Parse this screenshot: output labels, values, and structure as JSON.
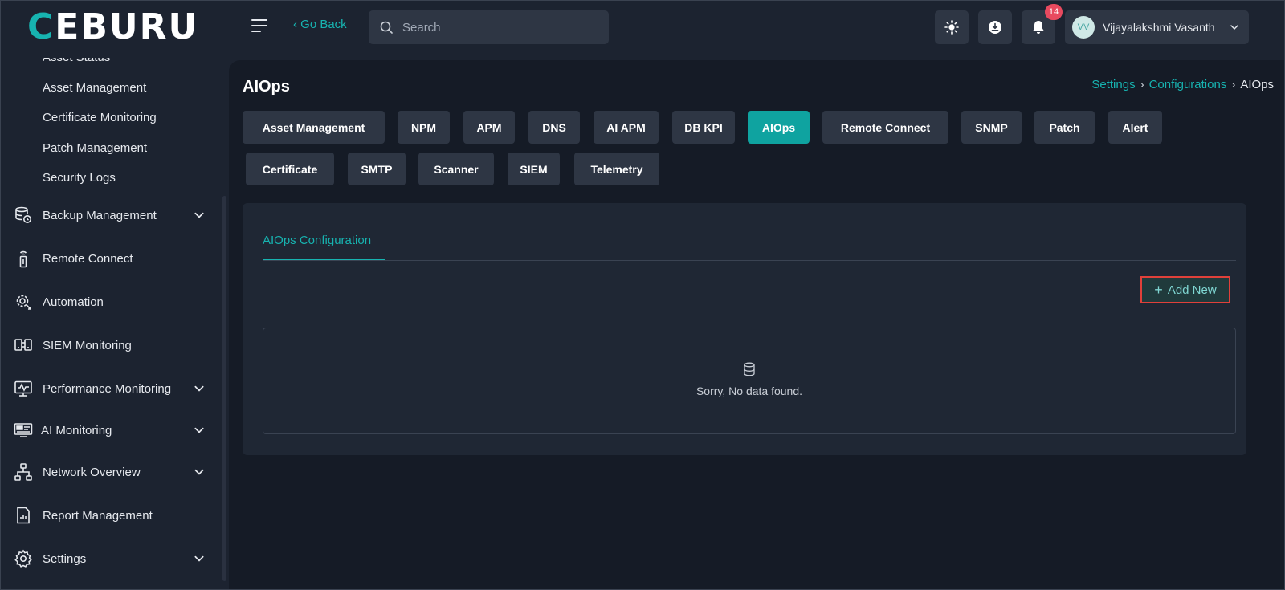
{
  "header": {
    "logo_text": "CEBURU",
    "go_back": "‹ Go Back",
    "search_placeholder": "Search",
    "notification_count": "14",
    "user": {
      "initials": "VV",
      "name": "Vijayalakshmi Vasanth"
    }
  },
  "sidebar": {
    "sub_items": [
      "Asset Status",
      "Asset Management",
      "Certificate Monitoring",
      "Patch Management",
      "Security Logs"
    ],
    "items": [
      {
        "label": "Backup Management",
        "icon": "backup-icon",
        "has_chevron": true
      },
      {
        "label": "Remote Connect",
        "icon": "remote-icon",
        "has_chevron": false
      },
      {
        "label": "Automation",
        "icon": "automation-icon",
        "has_chevron": false
      },
      {
        "label": "SIEM Monitoring",
        "icon": "siem-icon",
        "has_chevron": false
      },
      {
        "label": "Performance Monitoring",
        "icon": "performance-icon",
        "has_chevron": true
      },
      {
        "label": "AI Monitoring",
        "icon": "ai-monitor-icon",
        "has_chevron": true
      },
      {
        "label": "Network Overview",
        "icon": "network-icon",
        "has_chevron": true
      },
      {
        "label": "Report Management",
        "icon": "report-icon",
        "has_chevron": false
      },
      {
        "label": "Settings",
        "icon": "gear-icon",
        "has_chevron": true
      }
    ]
  },
  "main": {
    "title": "AIOps",
    "breadcrumb": {
      "settings": "Settings",
      "configurations": "Configurations",
      "current": "AIOps",
      "sep": "›"
    },
    "tabs_row1": [
      "Asset Management",
      "NPM",
      "APM",
      "DNS",
      "AI APM",
      "DB KPI",
      "AIOps",
      "Remote Connect",
      "SNMP",
      "Patch",
      "Alert"
    ],
    "tabs_row2": [
      "Certificate",
      "SMTP",
      "Scanner",
      "SIEM",
      "Telemetry"
    ],
    "active_tab": "AIOps",
    "card": {
      "subtab": "AIOps Configuration",
      "add_new": "Add New",
      "empty_text": "Sorry, No data found."
    }
  },
  "colors": {
    "accent": "#17b3b0",
    "active_tab": "#0fa3a0",
    "highlight_border": "#e0403a"
  }
}
